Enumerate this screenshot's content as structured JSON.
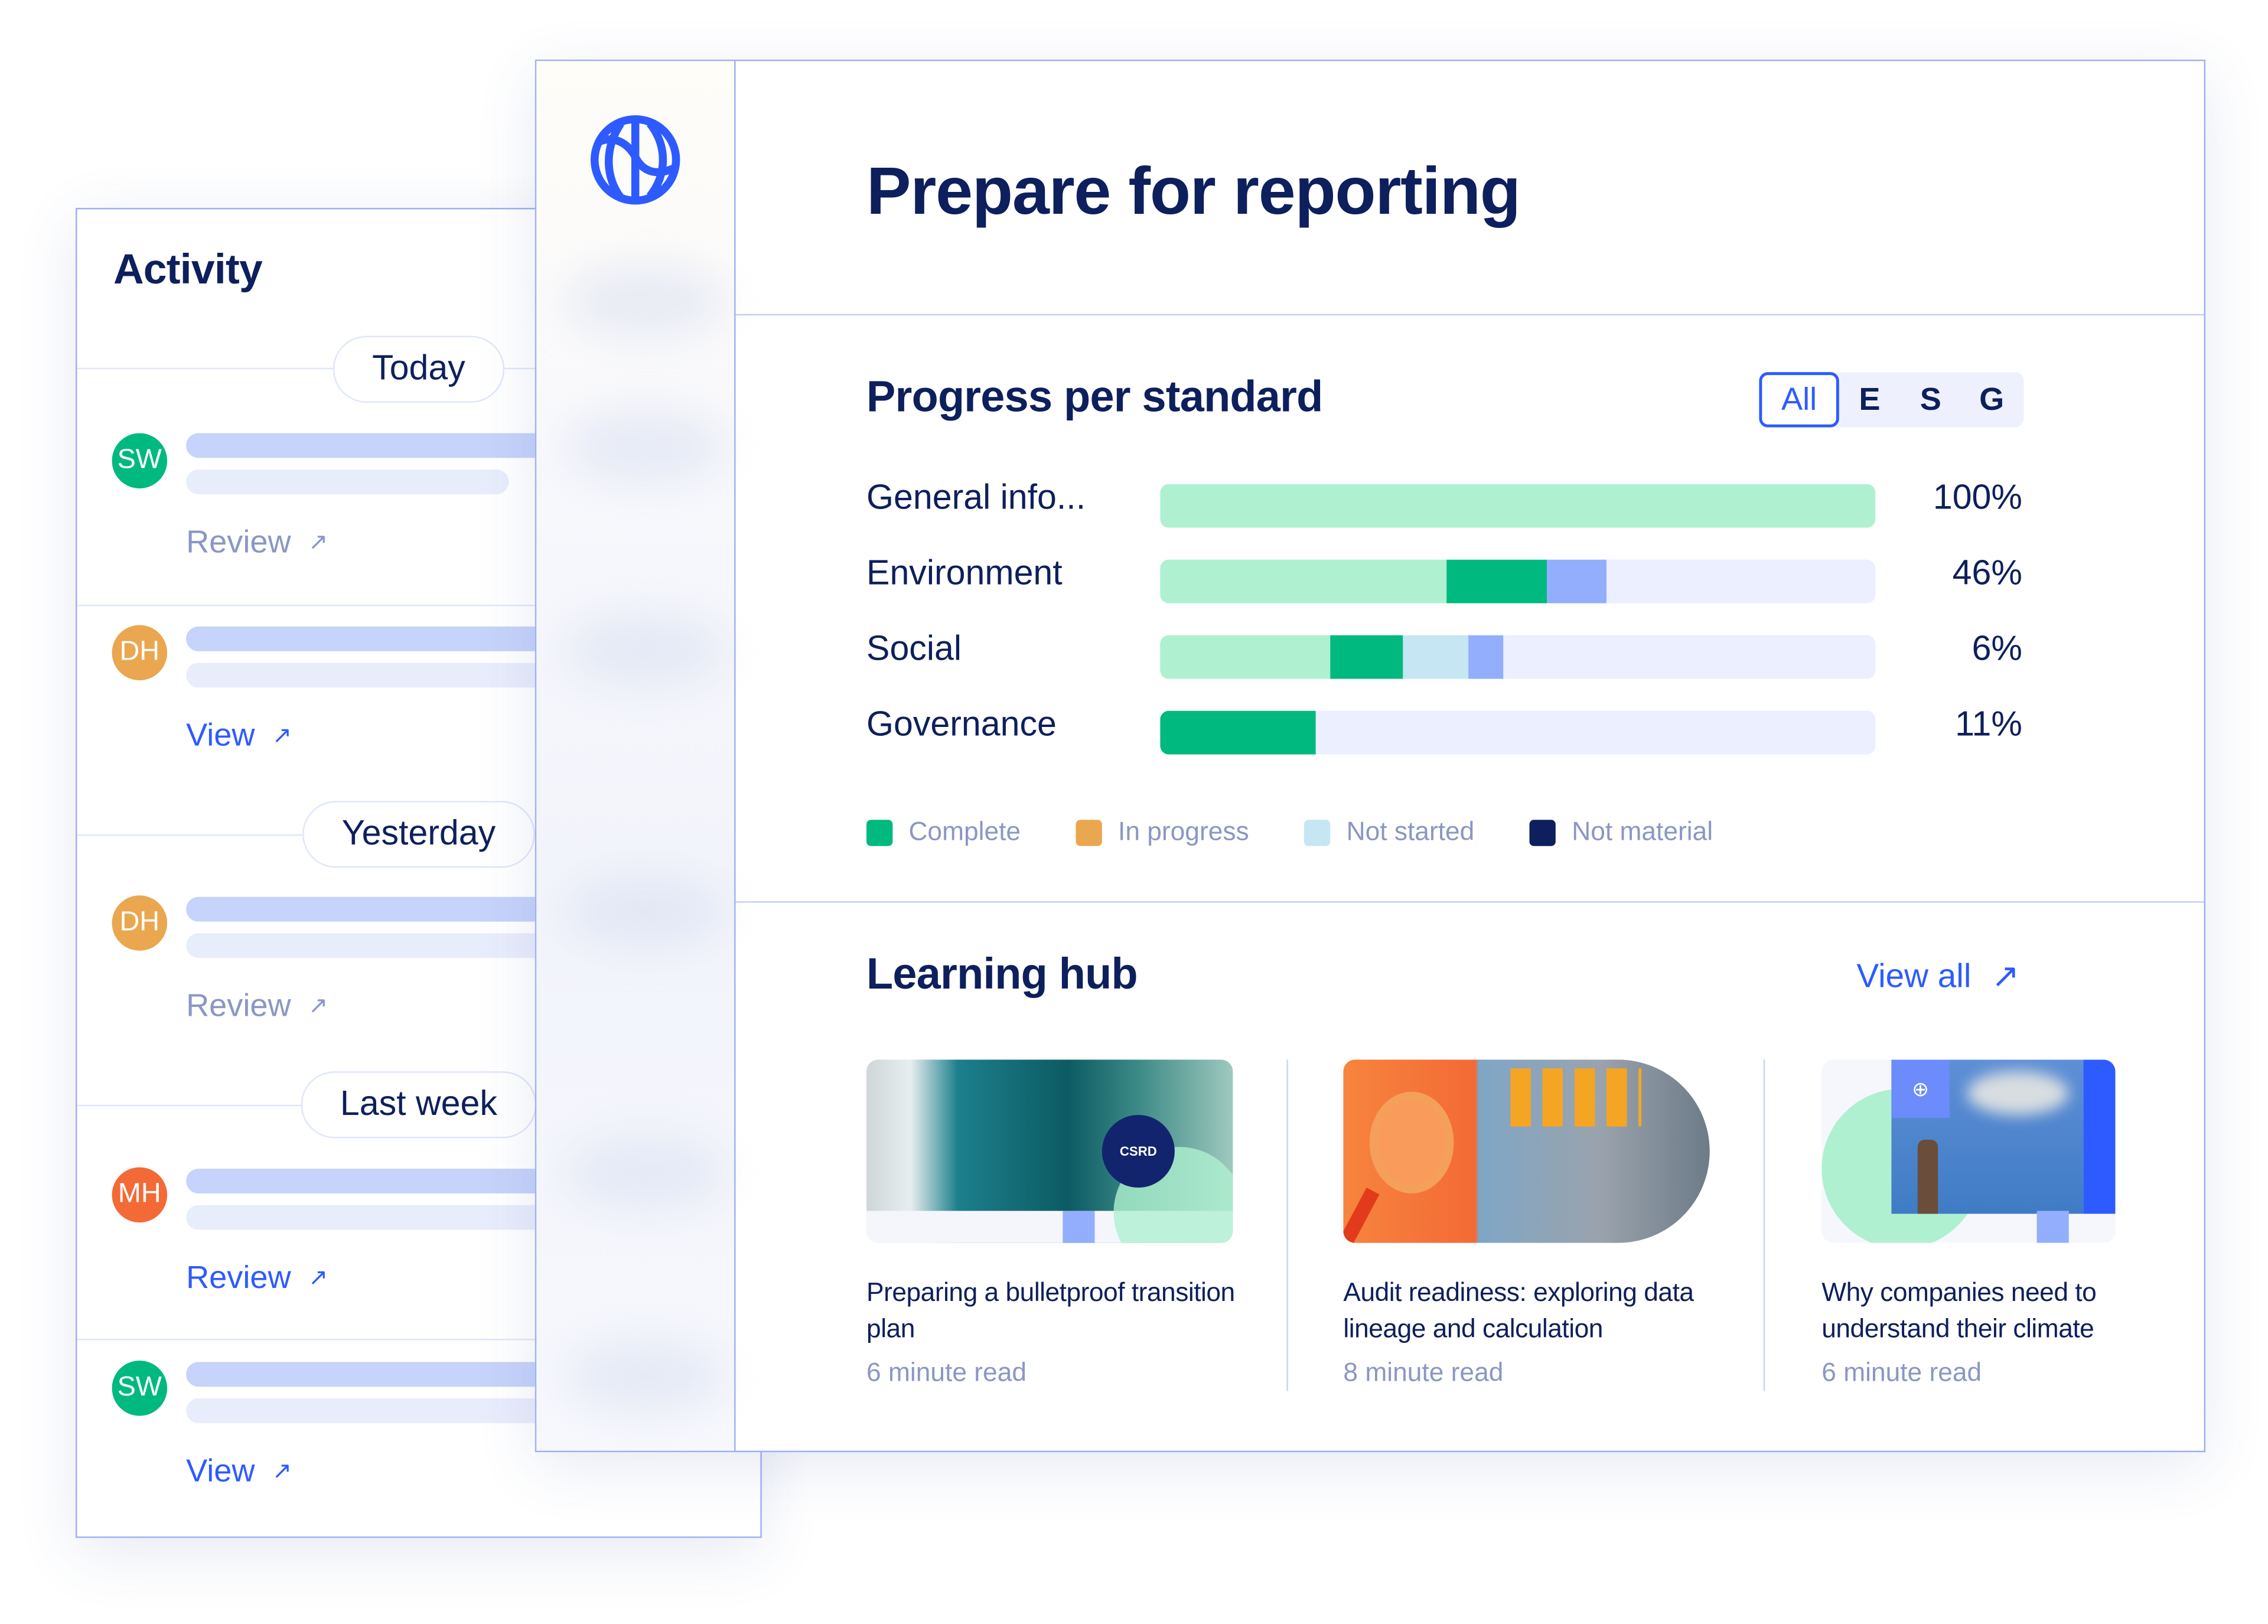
{
  "activity": {
    "title": "Activity",
    "groups": [
      {
        "label": "Today"
      },
      {
        "label": "Yesterday"
      },
      {
        "label": "Last week"
      }
    ],
    "items": [
      {
        "initials": "SW",
        "avatar_color": "#00b97f",
        "link": "Review",
        "link_color": "#8a97c4"
      },
      {
        "initials": "DH",
        "avatar_color": "#eaa74f",
        "link": "View",
        "link_color": "#2d5bff"
      },
      {
        "initials": "DH",
        "avatar_color": "#eaa74f",
        "link": "Review",
        "link_color": "#8a97c4"
      },
      {
        "initials": "MH",
        "avatar_color": "#f36a36",
        "link": "Review",
        "link_color": "#2d5bff"
      },
      {
        "initials": "SW",
        "avatar_color": "#00b97f",
        "link": "View",
        "link_color": "#2d5bff"
      }
    ],
    "link_icon": "arrow-up-right-icon"
  },
  "sidebar": {
    "logo_icon": "globe-logo-icon"
  },
  "header": {
    "title": "Prepare for reporting"
  },
  "progress": {
    "title": "Progress per standard",
    "filters": [
      "All",
      "E",
      "S",
      "G"
    ],
    "active_filter": "All",
    "rows": [
      {
        "label": "General info...",
        "percent": "100%",
        "segments": [
          {
            "color": "#aff0d0",
            "value": 100
          }
        ]
      },
      {
        "label": "Environment",
        "percent": "46%",
        "segments": [
          {
            "color": "#aff0d0",
            "value": 40
          },
          {
            "color": "#00b97f",
            "value": 14
          },
          {
            "color": "#93aefc",
            "value": 8.3
          }
        ]
      },
      {
        "label": "Social",
        "percent": "6%",
        "segments": [
          {
            "color": "#aff0d0",
            "value": 23.8
          },
          {
            "color": "#00b97f",
            "value": 10.2
          },
          {
            "color": "#c5e6f2",
            "value": 9.1
          },
          {
            "color": "#93aefc",
            "value": 4.9
          }
        ]
      },
      {
        "label": "Governance",
        "percent": "11%",
        "segments": [
          {
            "color": "#00b97f",
            "value": 21.8
          }
        ]
      }
    ],
    "legend": [
      {
        "label": "Complete",
        "color": "#00b97f"
      },
      {
        "label": "In progress",
        "color": "#eaa74f"
      },
      {
        "label": "Not started",
        "color": "#c5e6f2"
      },
      {
        "label": "Not material",
        "color": "#0d1f5c"
      }
    ]
  },
  "learning": {
    "title": "Learning hub",
    "view_all": "View all",
    "cards": [
      {
        "title": "Preparing a bulletproof transition plan",
        "read": "6 minute read",
        "badge": "CSRD"
      },
      {
        "title": "Audit readiness: exploring data lineage and calculation",
        "read": "8 minute read"
      },
      {
        "title": "Why companies need to understand their climate",
        "read": "6 minute read"
      }
    ]
  }
}
